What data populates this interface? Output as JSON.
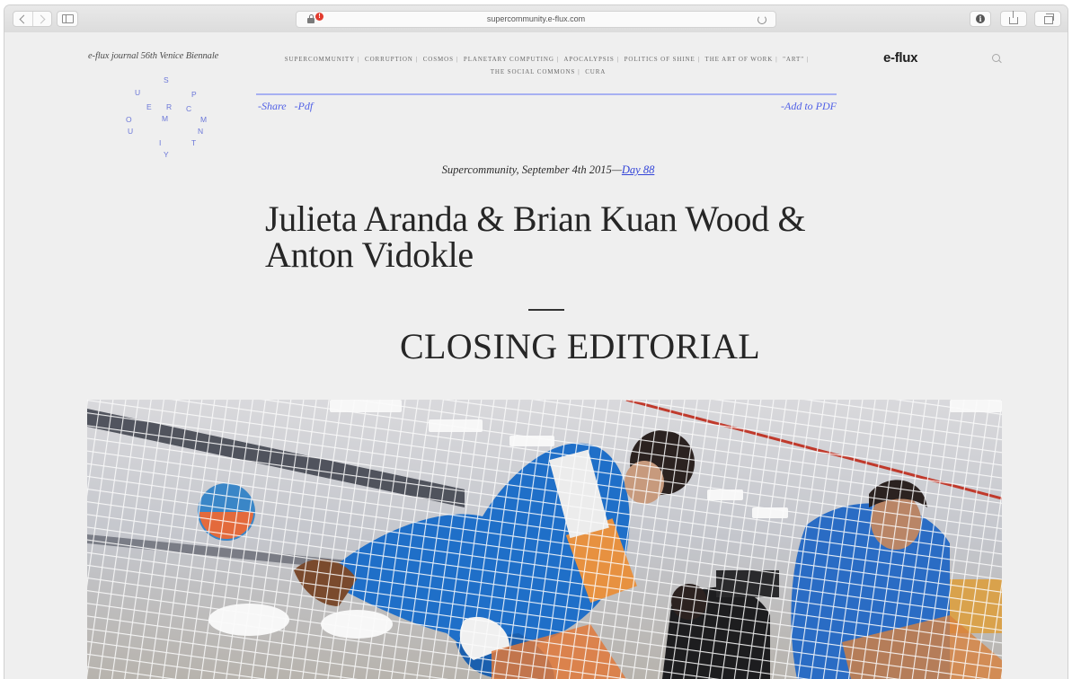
{
  "browser": {
    "url": "supercommunity.e-flux.com",
    "lock_badge": "!"
  },
  "header": {
    "journal_label": "e-flux journal 56th Venice Biennale",
    "brand": "e-flux",
    "nav_items": [
      "SUPERCOMMUNITY",
      "CORRUPTION",
      "COSMOS",
      "PLANETARY COMPUTING",
      "APOCALYPSIS",
      "POLITICS OF SHINE",
      "THE ART OF WORK",
      "\"ART\"",
      "THE SOCIAL COMMONS",
      "CURA"
    ],
    "nav_separator": "|"
  },
  "logo": {
    "letters": [
      "S",
      "U",
      "P",
      "E",
      "R",
      "C",
      "O",
      "M",
      "M",
      "U",
      "N",
      "I",
      "T",
      "Y"
    ]
  },
  "article": {
    "share_label": "-Share",
    "pdf_label": "-Pdf",
    "add_pdf_label": "-Add to PDF",
    "dateline_prefix": "Supercommunity, September 4th 2015—",
    "dateline_link": "Day 88",
    "authors": "Julieta Aranda & Brian Kuan Wood & Anton Vidokle",
    "title": "CLOSING EDITORIAL"
  },
  "colors": {
    "accent_link": "#5060e6",
    "rule": "#a7b0f2",
    "jumpsuit_blue": "#1f6fc8",
    "page_background": "#efefef"
  },
  "icons": {
    "back": "chevron-left-icon",
    "forward": "chevron-right-icon",
    "sidebar": "sidebar-icon",
    "lock": "lock-icon",
    "reload": "reload-icon",
    "info": "info-icon",
    "share": "share-icon",
    "tabs": "tabs-icon",
    "search": "search-icon"
  }
}
